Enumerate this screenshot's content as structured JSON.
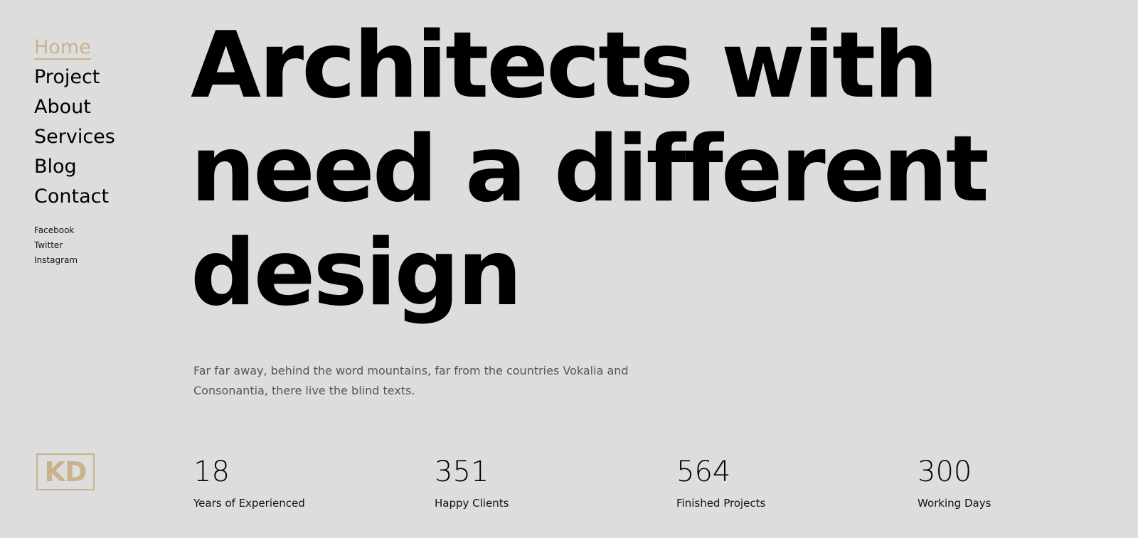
{
  "nav": {
    "items": [
      {
        "label": "Home",
        "active": true
      },
      {
        "label": "Project",
        "active": false
      },
      {
        "label": "About",
        "active": false
      },
      {
        "label": "Services",
        "active": false
      },
      {
        "label": "Blog",
        "active": false
      },
      {
        "label": "Contact",
        "active": false
      }
    ],
    "social": [
      "Facebook",
      "Twitter",
      "Instagram"
    ]
  },
  "hero": {
    "title_lines": [
      "Architects with",
      "need a different",
      "design"
    ],
    "description": "Far far away, behind the word mountains, far from the countries Vokalia and Consonantia, there live the blind texts."
  },
  "logo": {
    "text": "KD"
  },
  "stats": [
    {
      "number": "18",
      "label": "Years of Experienced"
    },
    {
      "number": "351",
      "label": "Happy Clients"
    },
    {
      "number": "564",
      "label": "Finished Projects"
    },
    {
      "number": "300",
      "label": "Working Days"
    }
  ],
  "colors": {
    "background": "#dddddd",
    "accent": "#c9b38c",
    "text": "#000000",
    "muted": "#555555"
  }
}
